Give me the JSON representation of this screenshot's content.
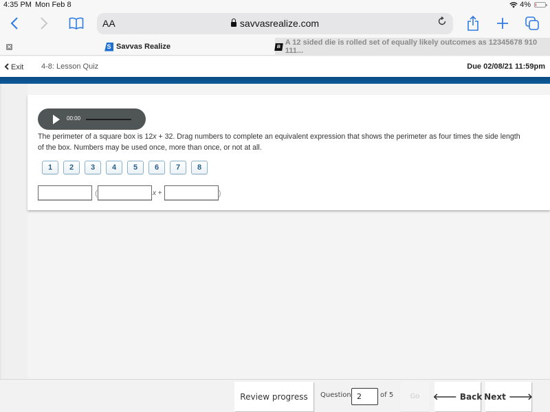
{
  "status_bar": {
    "time": "4:35 PM",
    "date": "Mon Feb 8",
    "battery": "4%",
    "wifi_icon": "wifi-icon"
  },
  "browser": {
    "url_text_size_label": "AA",
    "url_host": "savvasrealize.com",
    "icons": [
      "back-chevron-icon",
      "forward-chevron-icon",
      "bookmarks-book-icon",
      "lock-icon",
      "reload-icon",
      "share-icon",
      "new-tab-plus-icon",
      "tabs-overview-icon"
    ],
    "tabs": [
      {
        "title": "Savvas Realize",
        "favicon": "savvas-s-icon",
        "active": true
      },
      {
        "title": "A 12 sided die is rolled set of equally likely outcomes as 12345678 910 111...",
        "favicon": "brainly-b-icon",
        "active": false
      }
    ]
  },
  "header": {
    "exit_label": "Exit",
    "quiz_title": "4-8: Lesson Quiz",
    "due": "Due 02/08/21 11:59pm"
  },
  "question": {
    "audio_time": "00:00",
    "prompt_line1": "The perimeter of a square box is 12x + 32. Drag numbers to complete an equivalent expression that shows the perimeter as four times the side length",
    "prompt_line2": "of the box. Numbers may be used once, more than once, or not at all.",
    "tiles": [
      "1",
      "2",
      "3",
      "4",
      "5",
      "6",
      "7",
      "8"
    ],
    "expression": {
      "open_paren": "(",
      "x_plus": "x +",
      "close_paren": ")",
      "slots": [
        "",
        "",
        ""
      ]
    }
  },
  "footer": {
    "review_label": "Review progress",
    "question_label": "Question",
    "question_value": "2",
    "of_label": "of 5",
    "go_label": "Go",
    "back_label": "Back",
    "next_label": "Next"
  },
  "colors": {
    "accent_blue": "#0e5b9a",
    "browser_blue": "#2f7ae5",
    "tile_text": "#2a5f89"
  }
}
